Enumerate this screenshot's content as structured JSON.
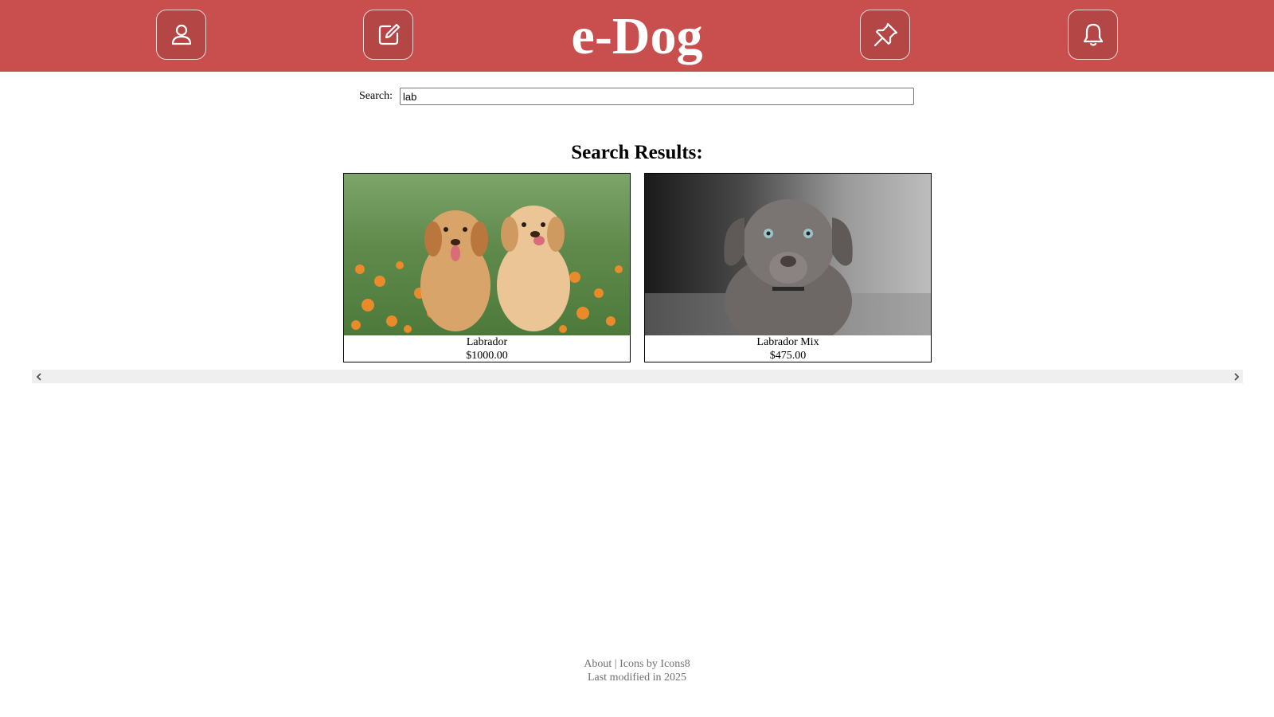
{
  "header": {
    "logo": "e-Dog",
    "background_color": "#c94e4e",
    "buttons": [
      {
        "name": "profile",
        "icon": "user-icon"
      },
      {
        "name": "create-post",
        "icon": "edit-icon"
      },
      {
        "name": "pinned",
        "icon": "pin-icon"
      },
      {
        "name": "notifications",
        "icon": "bell-icon"
      }
    ]
  },
  "search": {
    "label": "Search:",
    "value": "lab"
  },
  "results": {
    "title": "Search Results:",
    "items": [
      {
        "name": "Labrador",
        "price": "$1000.00",
        "image": "two-golden-puppies-photo"
      },
      {
        "name": "Labrador Mix",
        "price": "$475.00",
        "image": "grey-puppy-photo"
      }
    ]
  },
  "scrollbar": {
    "left_icon": "chevron-left-icon",
    "right_icon": "chevron-right-icon"
  },
  "footer": {
    "about_link": "About",
    "separator": "|",
    "credit_link": "Icons by Icons8",
    "modified": "Last modified in 2025"
  }
}
